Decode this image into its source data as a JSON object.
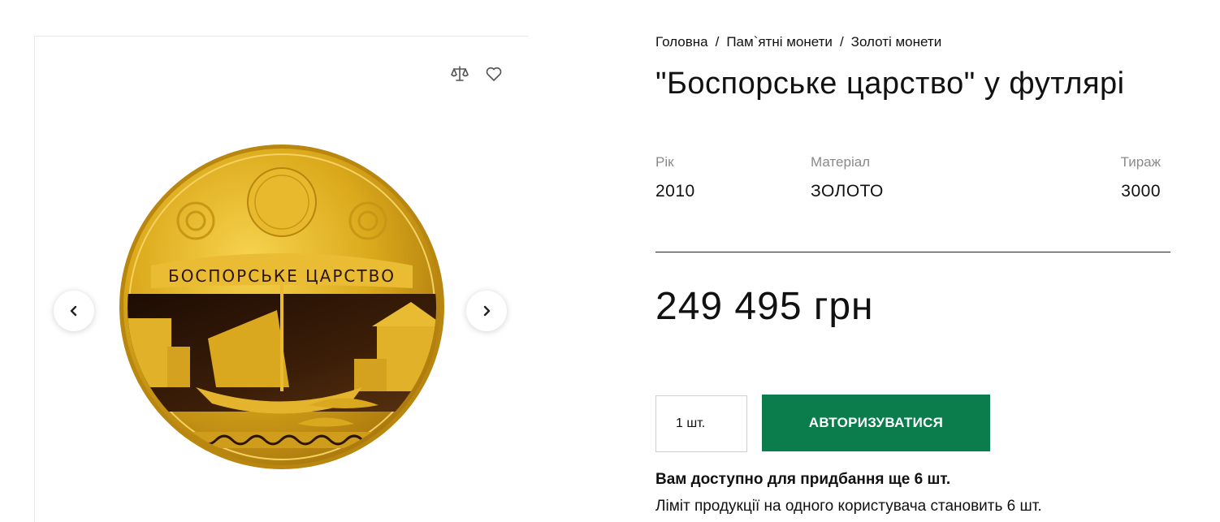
{
  "gallery": {
    "compare_icon": "scales-icon",
    "favorite_icon": "heart-icon",
    "prev_icon": "chevron-left-icon",
    "next_icon": "chevron-right-icon",
    "coin_inscription": "БОСПОРСЬКЕ ЦАРСТВО"
  },
  "breadcrumb": {
    "items": [
      "Головна",
      "Пам`ятні монети",
      "Золоті монети"
    ],
    "separator": "/"
  },
  "product": {
    "title": "\"Боспорське царство\" у футлярі",
    "specs": {
      "year_label": "Рік",
      "year_value": "2010",
      "material_label": "Матеріал",
      "material_value": "ЗОЛОТО",
      "mintage_label": "Тираж",
      "mintage_value": "3000"
    },
    "price": "249 495 грн",
    "quantity": "1 шт.",
    "auth_button": "АВТОРИЗУВАТИСЯ",
    "availability": "Вам доступно для придбання ще 6 шт.",
    "limit": "Ліміт продукції на одного користувача становить 6 шт."
  },
  "colors": {
    "accent": "#0b7d4c",
    "gold": "#d9a91f",
    "coin_dark": "#2a1406"
  }
}
